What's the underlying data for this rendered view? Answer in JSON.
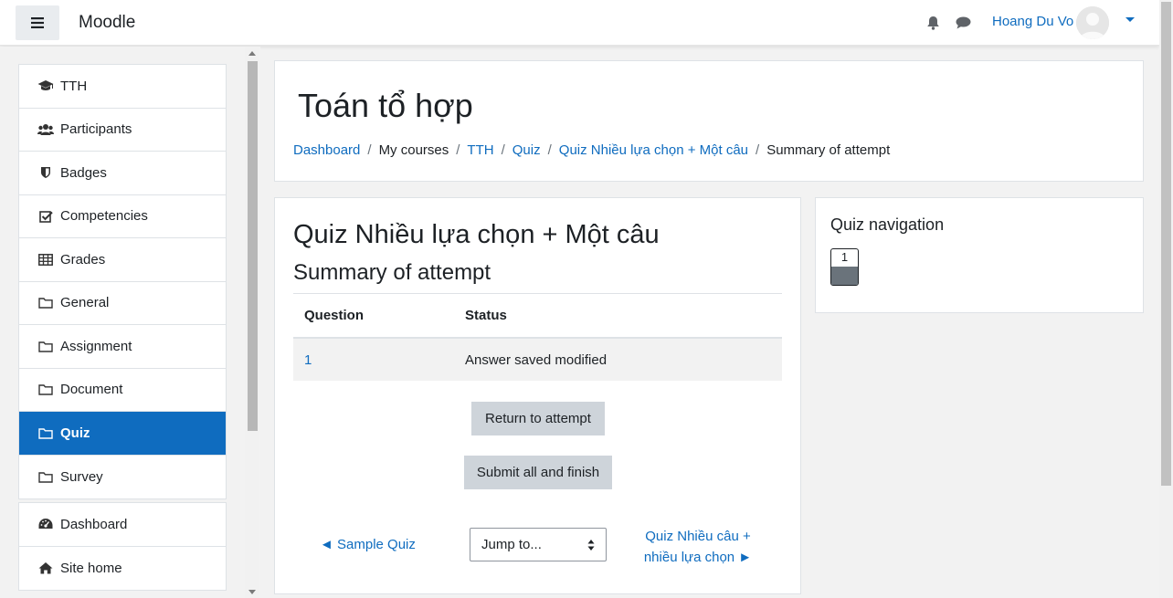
{
  "navbar": {
    "brand": "Moodle",
    "user_name": "Hoang Du Vo"
  },
  "sidebar": {
    "course_items": [
      {
        "label": "TTH",
        "icon": "graduation-cap-icon"
      },
      {
        "label": "Participants",
        "icon": "users-icon"
      },
      {
        "label": "Badges",
        "icon": "shield-icon"
      },
      {
        "label": "Competencies",
        "icon": "check-square-icon"
      },
      {
        "label": "Grades",
        "icon": "table-icon"
      },
      {
        "label": "General",
        "icon": "folder-icon"
      },
      {
        "label": "Assignment",
        "icon": "folder-icon"
      },
      {
        "label": "Document",
        "icon": "folder-icon"
      },
      {
        "label": "Quiz",
        "icon": "folder-icon",
        "active": true
      },
      {
        "label": "Survey",
        "icon": "folder-icon"
      }
    ],
    "site_items": [
      {
        "label": "Dashboard",
        "icon": "dashboard-icon"
      },
      {
        "label": "Site home",
        "icon": "home-icon"
      }
    ]
  },
  "header": {
    "title": "Toán tổ hợp",
    "breadcrumb": [
      "Dashboard",
      "My courses",
      "TTH",
      "Quiz",
      "Quiz Nhiều lựa chọn + Một câu",
      "Summary of attempt"
    ]
  },
  "main": {
    "quiz_title": "Quiz Nhiều lựa chọn + Một câu",
    "summary_title": "Summary of attempt",
    "table": {
      "headers": [
        "Question",
        "Status"
      ],
      "rows": [
        {
          "question": "1",
          "status": "Answer saved modified"
        }
      ]
    },
    "return_button": "Return to attempt",
    "submit_button": "Submit all and finish",
    "prev_activity": "◄ Sample Quiz",
    "jump_placeholder": "Jump to...",
    "next_activity": "Quiz Nhiều câu + nhiều lựa chọn ►"
  },
  "quiz_navigation": {
    "title": "Quiz navigation",
    "questions": [
      "1"
    ]
  },
  "colors": {
    "accent": "#0f6cbf",
    "button_bg": "#ced4da",
    "page_bg": "#f2f2f2"
  }
}
